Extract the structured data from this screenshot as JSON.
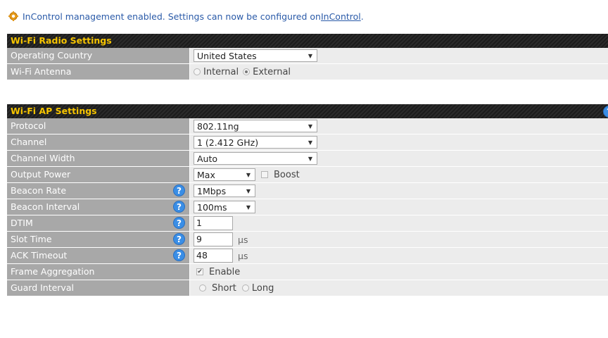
{
  "notice": {
    "icon": "gear-icon",
    "prefix": "InControl management enabled. Settings can now be configured on ",
    "link": "InControl",
    "suffix": "."
  },
  "radio_settings": {
    "title": "Wi-Fi Radio Settings",
    "operating_country": {
      "label": "Operating Country",
      "value": "United States"
    },
    "antenna": {
      "label": "Wi-Fi Antenna",
      "options": [
        "Internal",
        "External"
      ],
      "selected": "External"
    }
  },
  "ap_settings": {
    "title": "Wi-Fi AP Settings",
    "help_glyph": "?",
    "protocol": {
      "label": "Protocol",
      "value": "802.11ng"
    },
    "channel": {
      "label": "Channel",
      "value": "1 (2.412 GHz)"
    },
    "channel_width": {
      "label": "Channel Width",
      "value": "Auto"
    },
    "output_power": {
      "label": "Output Power",
      "value": "Max",
      "boost_label": "Boost",
      "boost_checked": false
    },
    "beacon_rate": {
      "label": "Beacon Rate",
      "value": "1Mbps"
    },
    "beacon_interval": {
      "label": "Beacon Interval",
      "value": "100ms"
    },
    "dtim": {
      "label": "DTIM",
      "value": "1"
    },
    "slot_time": {
      "label": "Slot Time",
      "value": "9",
      "unit": "µs"
    },
    "ack_timeout": {
      "label": "ACK Timeout",
      "value": "48",
      "unit": "µs"
    },
    "frame_aggregation": {
      "label": "Frame Aggregation",
      "option": "Enable",
      "checked": true
    },
    "guard_interval": {
      "label": "Guard Interval",
      "options": [
        "Short",
        "Long"
      ],
      "selected": ""
    }
  },
  "colors": {
    "header_text": "#f6c400",
    "label_bg": "#a8a8a8",
    "value_bg": "#ececec",
    "help_blue": "#3a8ee6",
    "link": "#2a5aa8"
  }
}
